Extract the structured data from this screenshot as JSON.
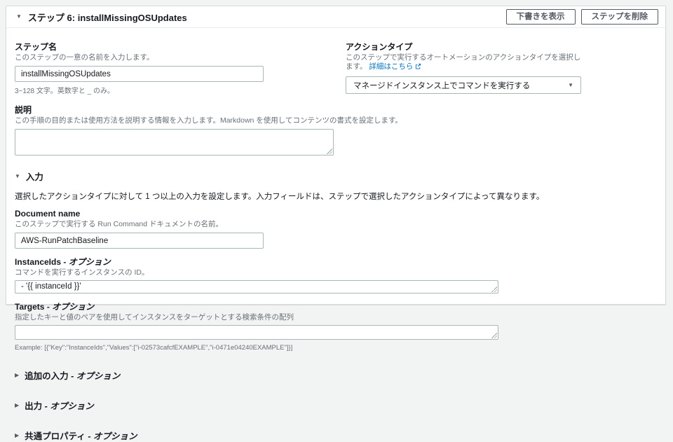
{
  "icons": {
    "collapse": "▼",
    "expand": "▶",
    "dropdown": "▼"
  },
  "colors": {
    "link": "#0073bb",
    "text": "#16191f",
    "help": "#687078",
    "border": "#aab7b8",
    "button": "#545b64",
    "page_bg": "#f2f3f3"
  },
  "header": {
    "title": "ステップ 6: installMissingOSUpdates",
    "show_draft_button": "下書きを表示",
    "delete_step_button": "ステップを削除"
  },
  "step_name": {
    "label": "ステップ名",
    "help": "このステップの一意の名前を入力します。",
    "value": "installMissingOSUpdates",
    "hint": "3~128 文字。英数字と _ のみ。"
  },
  "action_type": {
    "label": "アクションタイプ",
    "help": "このステップで実行するオートメーションのアクションタイプを選択します。",
    "link_label": "詳細はこちら",
    "selected": "マネージドインスタンス上でコマンドを実行する"
  },
  "description": {
    "label": "説明",
    "help": "この手順の目的または使用方法を説明する情報を入力します。Markdown を使用してコンテンツの書式を設定します。",
    "value": ""
  },
  "input_section": {
    "title": "入力",
    "intro": "選択したアクションタイプに対して 1 つ以上の入力を設定します。入力フィールドは、ステップで選択したアクションタイプによって異なります。",
    "document_name": {
      "label": "Document name",
      "help": "このステップで実行する Run Command ドキュメントの名前。",
      "value": "AWS-RunPatchBaseline"
    },
    "instance_ids": {
      "label": "InstanceIds",
      "optional": "- オプション",
      "help": "コマンドを実行するインスタンスの ID。",
      "value": "- '{{ instanceId }}'"
    },
    "targets": {
      "label": "Targets",
      "optional": "- オプション",
      "help": "指定したキーと値のペアを使用してインスタンスをターゲットとする検索条件の配列",
      "value": "",
      "example": "Example: [{\"Key\":\"InstanceIds\",\"Values\":[\"i-02573cafcfEXAMPLE\",\"i-0471e04240EXAMPLE\"]}]"
    }
  },
  "collapsed_sections": [
    {
      "label": "追加の入力",
      "optional": "- オプション"
    },
    {
      "label": "出力",
      "optional": "- オプション"
    },
    {
      "label": "共通プロパティ",
      "optional": "- オプション"
    }
  ]
}
